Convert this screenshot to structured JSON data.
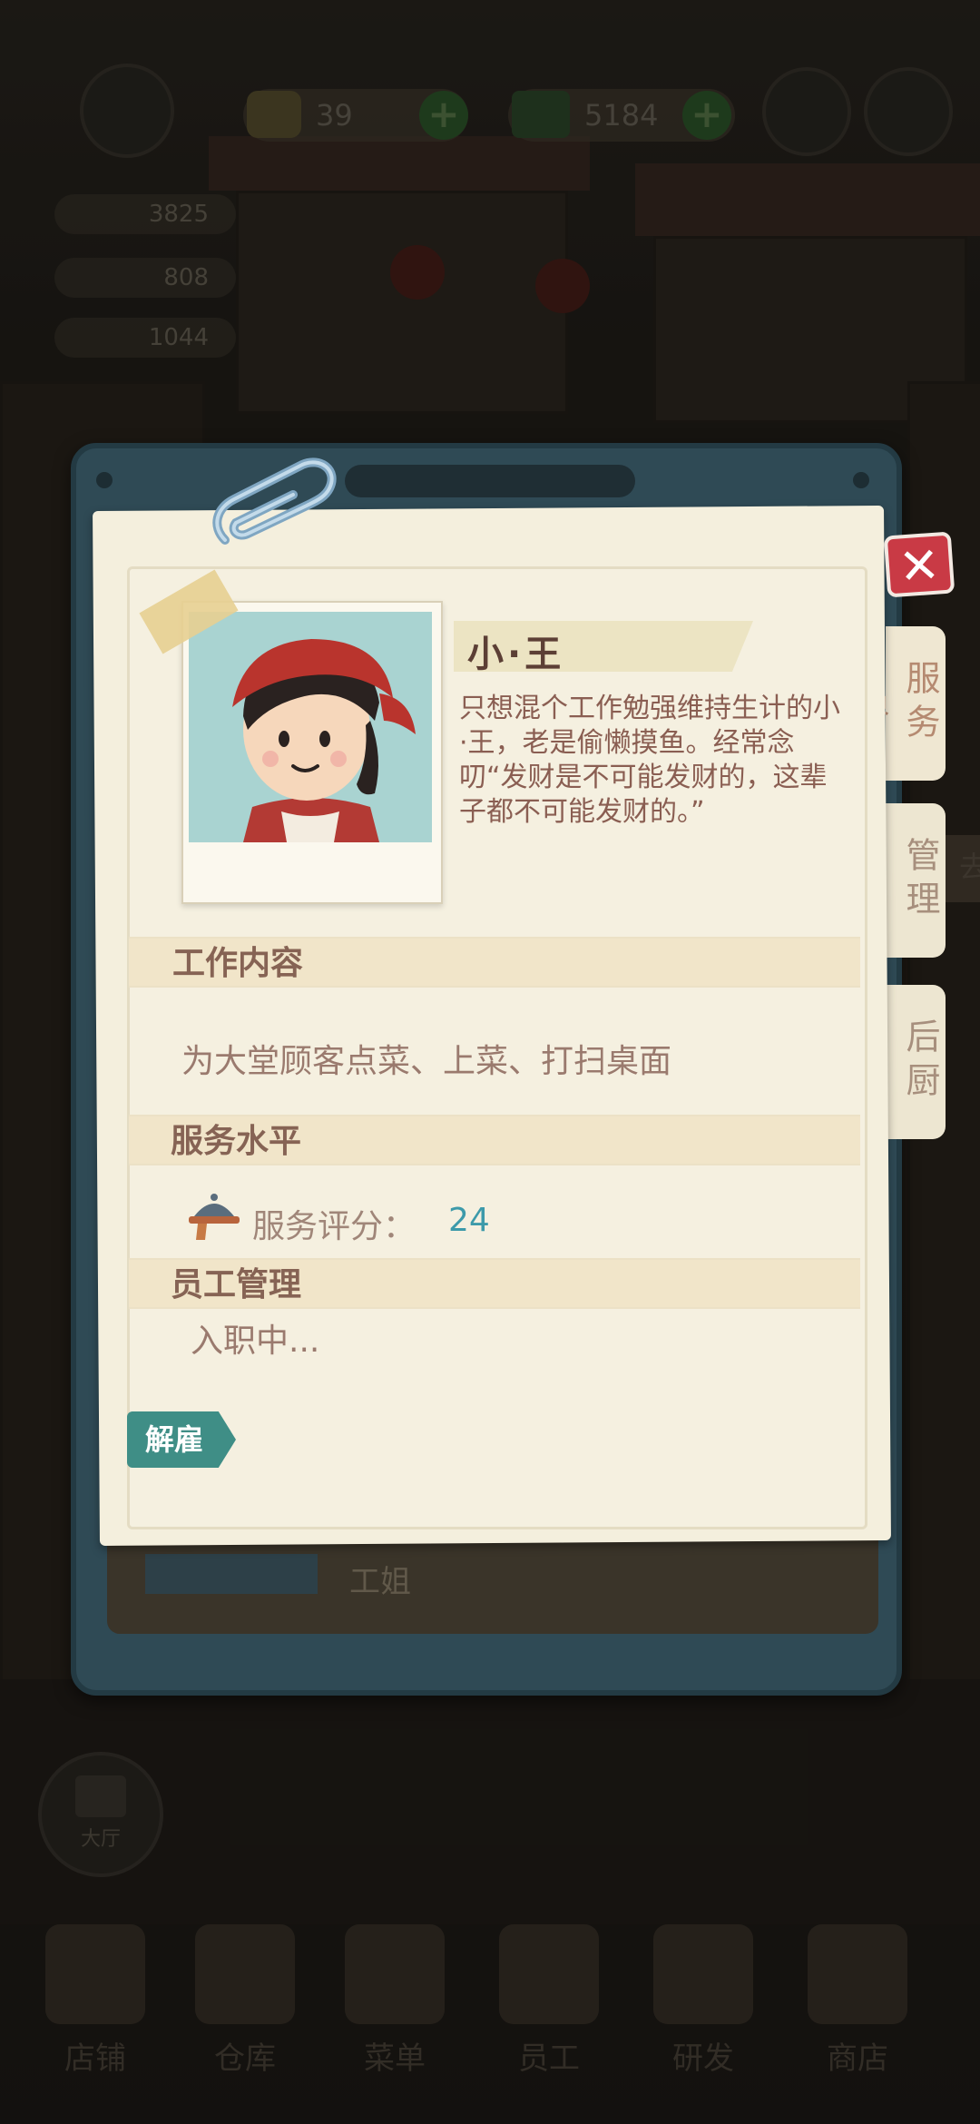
{
  "hud": {
    "gems": "39",
    "cash": "5184",
    "stats": [
      "3825",
      "808",
      "1044"
    ]
  },
  "background": {
    "left_tab": "去",
    "hall_button": "大厅",
    "wall_sign": "工姐"
  },
  "bottom_nav": [
    {
      "label": "店铺"
    },
    {
      "label": "仓库"
    },
    {
      "label": "菜单"
    },
    {
      "label": "员工"
    },
    {
      "label": "研发"
    },
    {
      "label": "商店"
    }
  ],
  "modal": {
    "close_icon": "✕",
    "tabs": [
      {
        "label": "服务员",
        "active": true
      },
      {
        "label": "管理",
        "active": false
      },
      {
        "label": "后厨",
        "active": false
      }
    ],
    "staff": {
      "name": "小·王",
      "description": "只想混个工作勉强维持生计的小·王，老是偷懒摸鱼。经常念叨“发财是不可能发财的，这辈子都不可能发财的。”"
    },
    "sections": {
      "work": {
        "title": "工作内容",
        "content": "为大堂顾客点菜、上菜、打扫桌面"
      },
      "service": {
        "title": "服务水平",
        "rating_label": "服务评分：",
        "rating_value": "24"
      },
      "management": {
        "title": "员工管理",
        "status": "入职中..."
      }
    },
    "fire_button": "解雇"
  },
  "colors": {
    "accent_teal": "#3f8e86",
    "close_red": "#c93a45",
    "rating_blue": "#3d9aaa",
    "paper": "#f4efdd"
  }
}
